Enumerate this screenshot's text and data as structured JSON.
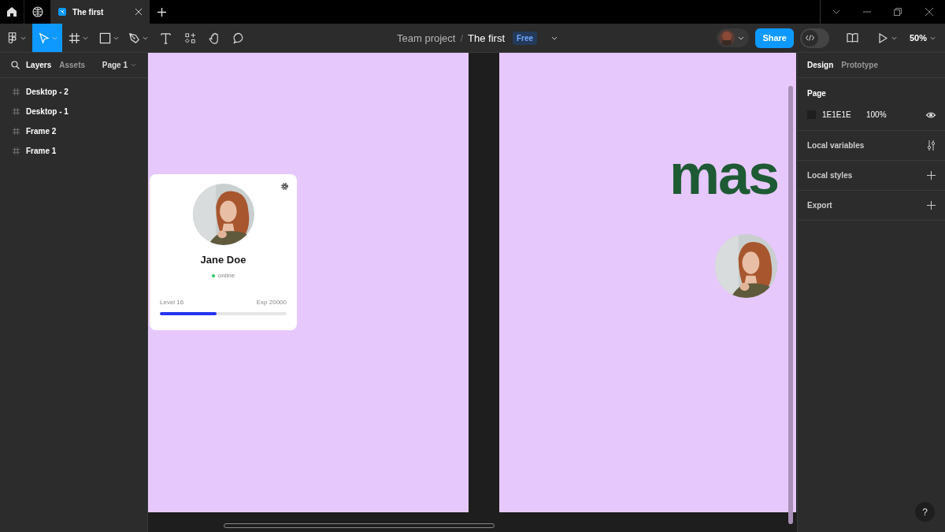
{
  "tabs": [
    {
      "title": "The first",
      "selected": true
    }
  ],
  "toolbar": {
    "tools": [
      {
        "kind": "logo",
        "selected": false,
        "menu": true
      },
      {
        "kind": "move",
        "selected": true,
        "menu": true
      },
      {
        "kind": "frame",
        "selected": false,
        "menu": true
      },
      {
        "kind": "shape",
        "selected": false,
        "menu": true
      },
      {
        "kind": "pen",
        "selected": false,
        "menu": true
      },
      {
        "kind": "text",
        "selected": false,
        "menu": false
      },
      {
        "kind": "resources",
        "selected": false,
        "menu": false
      },
      {
        "kind": "hand",
        "selected": false,
        "menu": false
      },
      {
        "kind": "comment",
        "selected": false,
        "menu": false
      }
    ],
    "project": "Team project",
    "separator": "/",
    "file": "The first",
    "plan": "Free",
    "share": "Share",
    "dev_mode": false,
    "zoom": "50%"
  },
  "left_panel": {
    "tabs": [
      {
        "label": "Layers",
        "selected": true
      },
      {
        "label": "Assets",
        "selected": false
      }
    ],
    "page": "Page 1",
    "layers": [
      {
        "name": "Desktop - 2"
      },
      {
        "name": "Desktop - 1"
      },
      {
        "name": "Frame 2"
      },
      {
        "name": "Frame 1"
      }
    ]
  },
  "canvas": {
    "card": {
      "name": "Jane Doe",
      "status": "online",
      "color": "#22c55e",
      "level_label": "Level 16",
      "exp_label": "Exp 20000",
      "level": 0.45
    },
    "headline": "mas"
  },
  "right_panel": {
    "tabs": [
      {
        "label": "Design",
        "selected": true
      },
      {
        "label": "Prototype",
        "selected": false
      }
    ],
    "page_title": "Page",
    "page_color": "1E1E1E",
    "page_opacity": "100%",
    "sections": [
      {
        "label": "Local variables",
        "kind": "variables"
      },
      {
        "label": "Local styles",
        "kind": "add"
      },
      {
        "label": "Export",
        "kind": "add"
      }
    ]
  },
  "help": "?"
}
